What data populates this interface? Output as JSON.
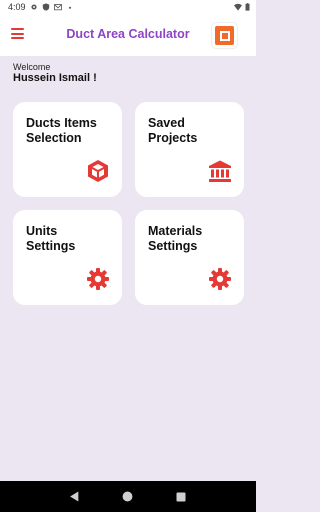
{
  "status_bar": {
    "time": "4:09",
    "icons": [
      "gear-icon",
      "shield-icon",
      "mail-icon",
      "wifi-icon",
      "battery-icon"
    ]
  },
  "app_bar": {
    "title": "Duct Area Calculator",
    "menu_icon": "hamburger-menu-icon",
    "logo_icon": "app-logo-icon"
  },
  "greeting": {
    "welcome": "Welcome",
    "user": "Hussein Ismail !"
  },
  "cards": [
    {
      "line1": "Ducts Items",
      "line2": "Selection",
      "icon": "cube-icon"
    },
    {
      "line1": "Saved",
      "line2": "Projects",
      "icon": "bank-icon"
    },
    {
      "line1": "Units",
      "line2": "Settings",
      "icon": "gear-icon"
    },
    {
      "line1": "Materials",
      "line2": "Settings",
      "icon": "gear-icon"
    }
  ],
  "colors": {
    "accent": "#e53935",
    "title": "#8e44c7",
    "background": "#ece6f3",
    "logo": "#f06a2b"
  },
  "nav_bar": {
    "icons": [
      "back-icon",
      "home-icon",
      "recents-icon"
    ]
  }
}
